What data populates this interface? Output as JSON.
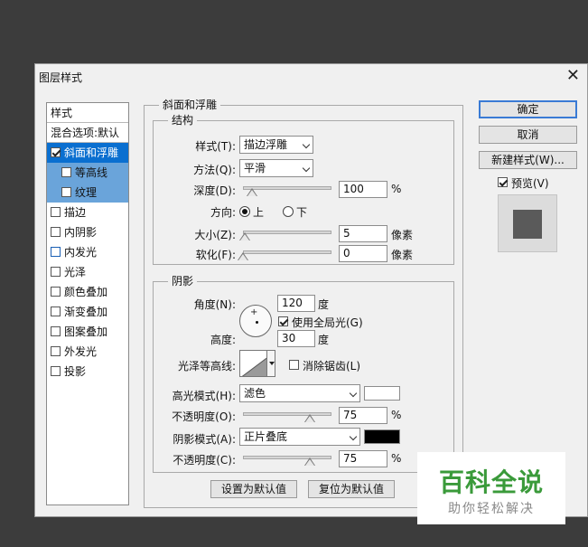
{
  "dialog": {
    "title": "图层样式",
    "close": "✕"
  },
  "styles_panel": {
    "header": "样式",
    "blend_options": "混合选项:默认",
    "items": [
      {
        "label": "斜面和浮雕",
        "checked": true
      },
      {
        "label": "等高线",
        "checked": false
      },
      {
        "label": "纹理",
        "checked": false
      },
      {
        "label": "描边",
        "checked": false
      },
      {
        "label": "内阴影",
        "checked": false
      },
      {
        "label": "内发光",
        "checked": false
      },
      {
        "label": "光泽",
        "checked": false
      },
      {
        "label": "颜色叠加",
        "checked": false
      },
      {
        "label": "渐变叠加",
        "checked": false
      },
      {
        "label": "图案叠加",
        "checked": false
      },
      {
        "label": "外发光",
        "checked": false
      },
      {
        "label": "投影",
        "checked": false
      }
    ]
  },
  "bevel": {
    "legend": "斜面和浮雕",
    "structure": {
      "legend": "结构",
      "style_label": "样式(T):",
      "style_value": "描边浮雕",
      "technique_label": "方法(Q):",
      "technique_value": "平滑",
      "depth_label": "深度(D):",
      "depth_value": "100",
      "depth_unit": "%",
      "depth_level": 0.1,
      "direction_label": "方向:",
      "direction_up": "上",
      "direction_down": "下",
      "size_label": "大小(Z):",
      "size_value": "5",
      "size_unit": "像素",
      "size_level": 0.02,
      "soften_label": "软化(F):",
      "soften_value": "0",
      "soften_unit": "像素",
      "soften_level": 0
    },
    "shading": {
      "legend": "阴影",
      "angle_label": "角度(N):",
      "angle_value": "120",
      "angle_unit": "度",
      "global_light_label": "使用全局光(G)",
      "altitude_label": "高度:",
      "altitude_value": "30",
      "altitude_unit": "度",
      "gloss_label": "光泽等高线:",
      "antialias_label": "消除锯齿(L)",
      "highlight_mode_label": "高光模式(H):",
      "highlight_mode_value": "滤色",
      "highlight_color": "#ffffff",
      "highlight_opacity_label": "不透明度(O):",
      "highlight_opacity_value": "75",
      "highlight_opacity_unit": "%",
      "highlight_opacity_level": 0.75,
      "shadow_mode_label": "阴影模式(A):",
      "shadow_mode_value": "正片叠底",
      "shadow_color": "#000000",
      "shadow_opacity_label": "不透明度(C):",
      "shadow_opacity_value": "75",
      "shadow_opacity_unit": "%",
      "shadow_opacity_level": 0.75
    },
    "make_default": "设置为默认值",
    "reset_default": "复位为默认值"
  },
  "buttons": {
    "ok": "确定",
    "cancel": "取消",
    "new_style": "新建样式(W)...",
    "preview_label": "预览(V)"
  },
  "watermark": {
    "title": "百科全说",
    "subtitle": "助你轻松解决"
  }
}
